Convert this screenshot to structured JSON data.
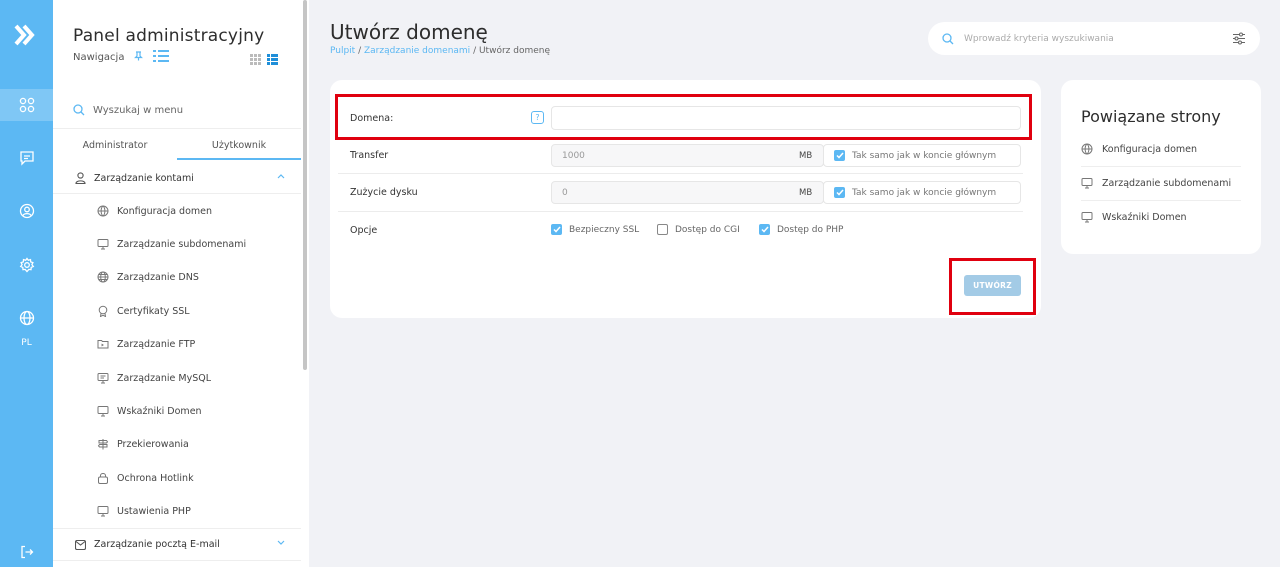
{
  "rail": {
    "lang": "PL",
    "icons": [
      "logo-icon",
      "dashboard-icon",
      "message-icon",
      "user-icon",
      "settings-icon",
      "globe-icon",
      "logout-icon"
    ]
  },
  "sidebar": {
    "title": "Panel administracyjny",
    "nav_label": "Nawigacja",
    "search_placeholder": "Wyszukaj w menu",
    "tabs": [
      "Administrator",
      "Użytkownik"
    ],
    "active_tab": "Użytkownik",
    "groups": [
      {
        "label": "Zarządzanie kontami",
        "expanded": true,
        "items": [
          {
            "label": "Konfiguracja domen",
            "icon": "domain-config-icon"
          },
          {
            "label": "Zarządzanie subdomenami",
            "icon": "monitor-icon"
          },
          {
            "label": "Zarządzanie DNS",
            "icon": "globe-icon"
          },
          {
            "label": "Certyfikaty SSL",
            "icon": "certificate-icon"
          },
          {
            "label": "Zarządzanie FTP",
            "icon": "folder-icon"
          },
          {
            "label": "Zarządzanie MySQL",
            "icon": "monitor-icon"
          },
          {
            "label": "Wskaźniki Domen",
            "icon": "monitor-icon"
          },
          {
            "label": "Przekierowania",
            "icon": "signpost-icon"
          },
          {
            "label": "Ochrona Hotlink",
            "icon": "lock-icon"
          },
          {
            "label": "Ustawienia PHP",
            "icon": "monitor-icon"
          }
        ]
      },
      {
        "label": "Zarządzanie pocztą E-mail",
        "expanded": false
      }
    ]
  },
  "header": {
    "title": "Utwórz domenę",
    "breadcrumb": [
      "Pulpit",
      "Zarządzanie domenami",
      "Utwórz domenę"
    ],
    "search_placeholder": "Wprowadź kryteria wyszukiwania"
  },
  "form": {
    "domain": {
      "label": "Domena:",
      "value": "",
      "help": "?"
    },
    "transfer": {
      "label": "Transfer",
      "value": "1000",
      "unit": "MB",
      "same_label": "Tak samo jak w koncie głównym",
      "same_checked": true
    },
    "disk": {
      "label": "Zużycie dysku",
      "value": "0",
      "unit": "MB",
      "same_label": "Tak samo jak w koncie głównym",
      "same_checked": true
    },
    "options": {
      "label": "Opcje",
      "items": [
        {
          "label": "Bezpieczny SSL",
          "checked": true
        },
        {
          "label": "Dostęp do CGI",
          "checked": false
        },
        {
          "label": "Dostęp do PHP",
          "checked": true
        }
      ]
    },
    "submit": "UTWÓRZ"
  },
  "related": {
    "title": "Powiązane strony",
    "links": [
      {
        "label": "Konfiguracja domen",
        "icon": "domain-config-icon"
      },
      {
        "label": "Zarządzanie subdomenami",
        "icon": "monitor-icon"
      },
      {
        "label": "Wskaźniki Domen",
        "icon": "monitor-icon"
      }
    ]
  },
  "colors": {
    "accent": "#5cb8f3",
    "highlight": "#e0000f",
    "button": "#a3cbe6"
  }
}
